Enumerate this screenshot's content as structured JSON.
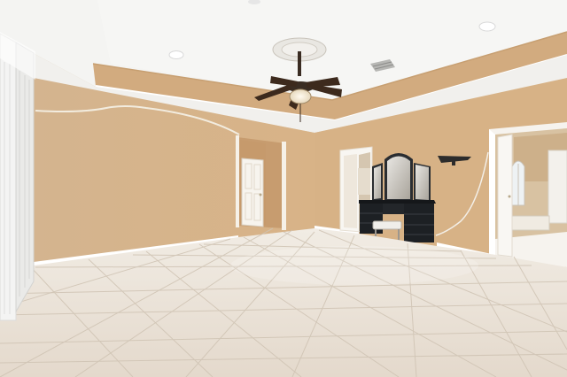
{
  "scene": {
    "kind": "photo",
    "subject": "empty room",
    "palette": {
      "wall": "#d6b289",
      "ceiling": "#f3f3f1",
      "floor": "#e6ded3",
      "trim": "#ffffff",
      "vanity": "#1e2125"
    },
    "objects": [
      "ceiling-fan",
      "recessed-lights",
      "ceiling-medallion",
      "air-vent",
      "closet-louvered-doors",
      "interior-door-left",
      "open-doorway-center",
      "vanity-with-mirrors",
      "wall-sconce",
      "bathroom-doorway",
      "tile-floor"
    ]
  }
}
